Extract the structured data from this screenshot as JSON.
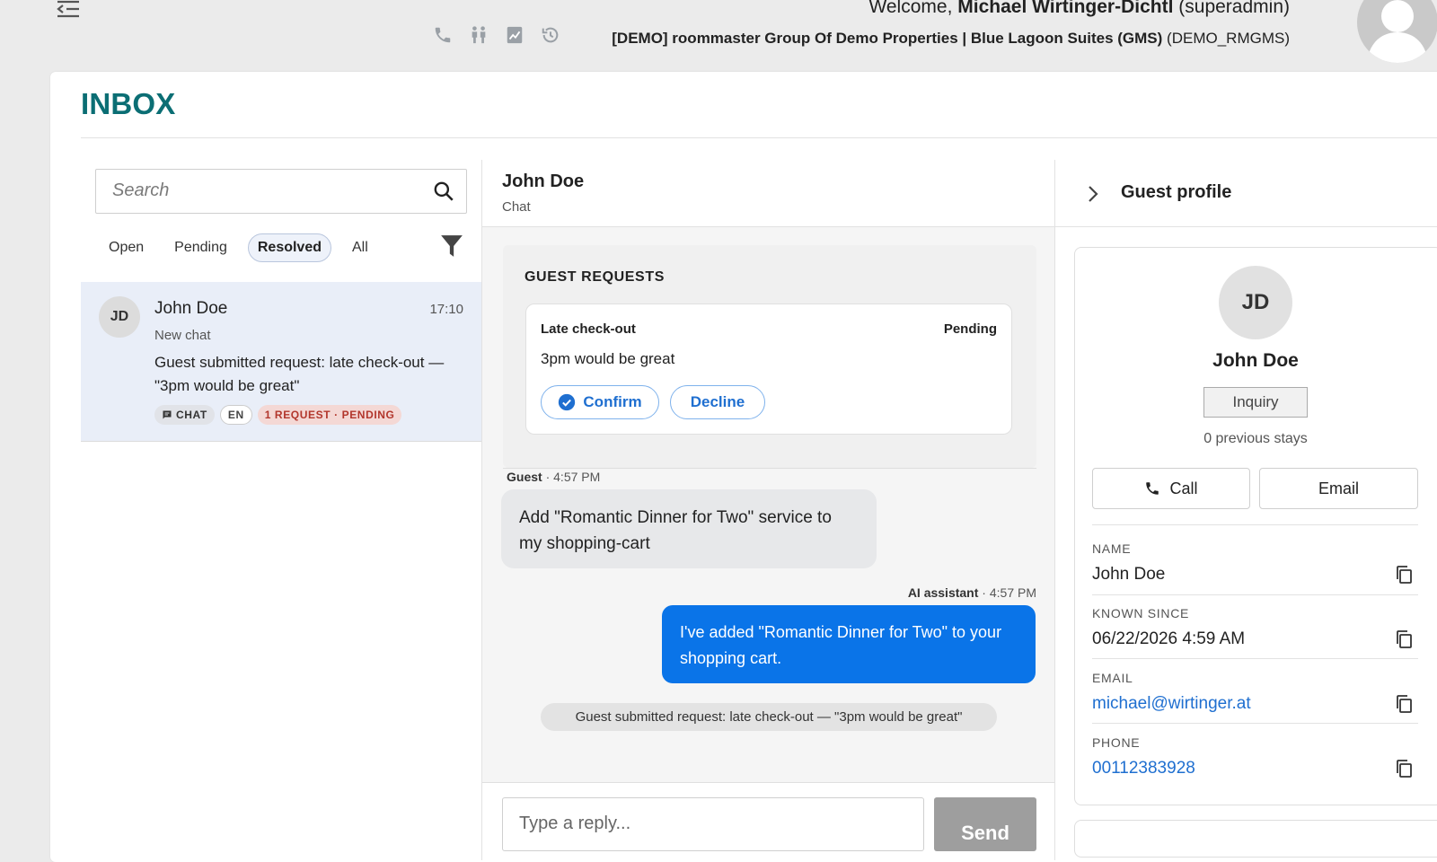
{
  "header": {
    "welcome_prefix": "Welcome,",
    "user_name": "Michael Wirtinger-Dichtl",
    "user_role": "(superadmin)",
    "property_name": "[DEMO] roommaster Group Of Demo Properties | Blue Lagoon Suites (GMS)",
    "property_code": "(DEMO_RMGMS)",
    "icons": [
      "phone-icon",
      "guests-icon",
      "report-icon",
      "history-icon"
    ]
  },
  "page": {
    "title": "INBOX"
  },
  "inbox": {
    "search_placeholder": "Search",
    "filters": [
      {
        "label": "Open",
        "active": false
      },
      {
        "label": "Pending",
        "active": false
      },
      {
        "label": "Resolved",
        "active": true
      },
      {
        "label": "All",
        "active": false
      }
    ],
    "conversations": [
      {
        "initials": "JD",
        "name": "John Doe",
        "time": "17:10",
        "subtitle": "New chat",
        "preview": "Guest submitted request: late check-out — \"3pm would be great\"",
        "badges": {
          "channel": "CHAT",
          "language": "EN",
          "status": "1 REQUEST · PENDING"
        }
      }
    ]
  },
  "chat": {
    "contact_name": "John Doe",
    "channel": "Chat",
    "guest_requests": {
      "title": "GUEST REQUESTS",
      "items": [
        {
          "type": "Late check-out",
          "status": "Pending",
          "text": "3pm would be great",
          "confirm_label": "Confirm",
          "decline_label": "Decline"
        }
      ]
    },
    "messages": [
      {
        "sender": "Guest",
        "time": "4:57 PM",
        "text": "Add \"Romantic Dinner for Two\" service to my shopping-cart"
      },
      {
        "sender": "AI assistant",
        "time": "4:57 PM",
        "text": "I've added \"Romantic Dinner for Two\" to your shopping cart."
      }
    ],
    "meta_separator": "·",
    "system_note": "Guest submitted request: late check-out — \"3pm would be great\"",
    "reply_placeholder": "Type a reply...",
    "send_label": "Send"
  },
  "guest_profile": {
    "title": "Guest profile",
    "initials": "JD",
    "name": "John Doe",
    "tag": "Inquiry",
    "stays": "0 previous stays",
    "call_label": "Call",
    "email_label": "Email",
    "fields": [
      {
        "label": "NAME",
        "value": "John Doe",
        "link": false
      },
      {
        "label": "KNOWN SINCE",
        "value": "06/22/2026 4:59 AM",
        "link": false
      },
      {
        "label": "EMAIL",
        "value": "michael@wirtinger.at",
        "link": true
      },
      {
        "label": "PHONE",
        "value": "00112383928",
        "link": true
      }
    ]
  },
  "colors": {
    "brand_teal": "#0b6e74",
    "primary_blue": "#0a74e8",
    "link_blue": "#1f6fd0",
    "pending_red": "#b2362c",
    "selected_row": "#e9eef8"
  }
}
